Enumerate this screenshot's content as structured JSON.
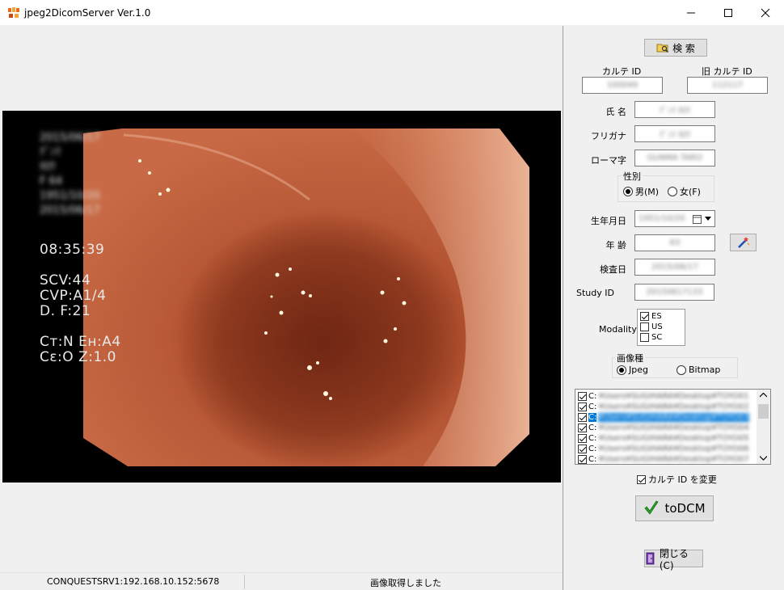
{
  "window": {
    "title": "jpeg2DicomServer Ver.1.0",
    "icon": "app-icon"
  },
  "osd": {
    "blurred_lines": [
      "2015/06/17",
      "ｸﾞﾝﾏ",
      "ﾀﾛｳ",
      "F  64",
      "1951/10/20",
      "2015/06/17"
    ],
    "time": "08:35:39",
    "scv": "SCV:44",
    "cvp": "CVP:A1/4",
    "df": "D. F:21",
    "ct_eh": "Cт:N Eн:A4",
    "ce_z": "Cε:O Z:1.0"
  },
  "status": {
    "server": "CONQUESTSRV1:192.168.10.152:5678",
    "message": "画像取得しました"
  },
  "search": {
    "label": "検 索",
    "icon": "search-folder-icon"
  },
  "patient": {
    "karte_id_label": "カルテ ID",
    "karte_id_value": "100049",
    "old_karte_id_label": "旧 カルテ ID",
    "old_karte_id_value": "112117",
    "name_label": "氏 名",
    "name_value": "ｸﾞﾝﾏ ﾀﾛｳ",
    "furigana_label": "フリガナ",
    "furigana_value": "ｸﾞﾝﾏ ﾀﾛｳ",
    "romaji_label": "ローマ字",
    "romaji_value": "GUNMA TARO",
    "sex_group_label": "性別",
    "sex_male": "男(M)",
    "sex_female": "女(F)",
    "birth_label": "生年月日",
    "birth_value": "1951/10/20",
    "age_label": "年 齢",
    "age_value": "63",
    "exam_date_label": "検査日",
    "exam_date_value": "2015/06/17",
    "study_id_label": "Study ID",
    "study_id_value": "20150617133",
    "modality_label": "Modality",
    "modalities": [
      {
        "label": "ES",
        "checked": true
      },
      {
        "label": "US",
        "checked": false
      },
      {
        "label": "SC",
        "checked": false
      }
    ],
    "image_type_label": "画像種",
    "image_type_jpeg": "Jpeg",
    "image_type_bitmap": "Bitmap"
  },
  "files": [
    {
      "prefix": "C:",
      "path": "¥Users¥SUGIHARA¥Desktop¥TOYO01",
      "checked": true,
      "selected": false
    },
    {
      "prefix": "C:",
      "path": "¥Users¥SUGIHARA¥Desktop¥TOYO02",
      "checked": true,
      "selected": false
    },
    {
      "prefix": "C:",
      "path": "¥Users¥SUGIHARA¥Desktop¥TOYO03",
      "checked": true,
      "selected": true
    },
    {
      "prefix": "C:",
      "path": "¥Users¥SUGIHARA¥Desktop¥TOYO04",
      "checked": true,
      "selected": false
    },
    {
      "prefix": "C:",
      "path": "¥Users¥SUGIHARA¥Desktop¥TOYO05",
      "checked": true,
      "selected": false
    },
    {
      "prefix": "C:",
      "path": "¥Users¥SUGIHARA¥Desktop¥TOYO06",
      "checked": true,
      "selected": false
    },
    {
      "prefix": "C:",
      "path": "¥Users¥SUGIHARA¥Desktop¥TOYO07",
      "checked": true,
      "selected": false
    }
  ],
  "change_karte_id_label": "カルテ ID を変更",
  "todcm": {
    "label": "toDCM",
    "icon": "green-check-icon"
  },
  "close": {
    "label": "閉じる(C)",
    "icon": "exit-door-icon"
  },
  "colors": {
    "selection": "#0078d7",
    "button_face": "#e1e1e1",
    "window_bg": "#f0f0f0",
    "check_green": "#2aa12a"
  }
}
